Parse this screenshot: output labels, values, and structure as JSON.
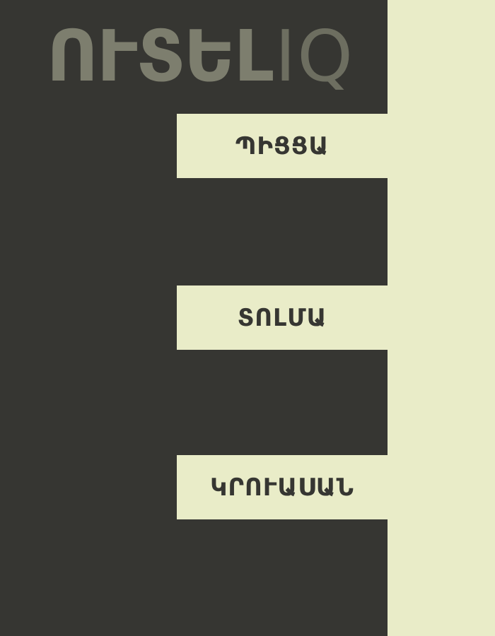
{
  "brand": {
    "logo_main": "ՈՒՏԵԼ",
    "logo_suffix": "IQ"
  },
  "menu": {
    "items": [
      {
        "label": "ՊԻՑՑԱ"
      },
      {
        "label": "ՏՈԼՄԱ"
      },
      {
        "label": "ԿՐՈՒԱՍԱՆ"
      }
    ]
  },
  "colors": {
    "dark_background": "#363632",
    "light_background": "#E9ECC8",
    "logo_text": "#7D7E6E"
  }
}
